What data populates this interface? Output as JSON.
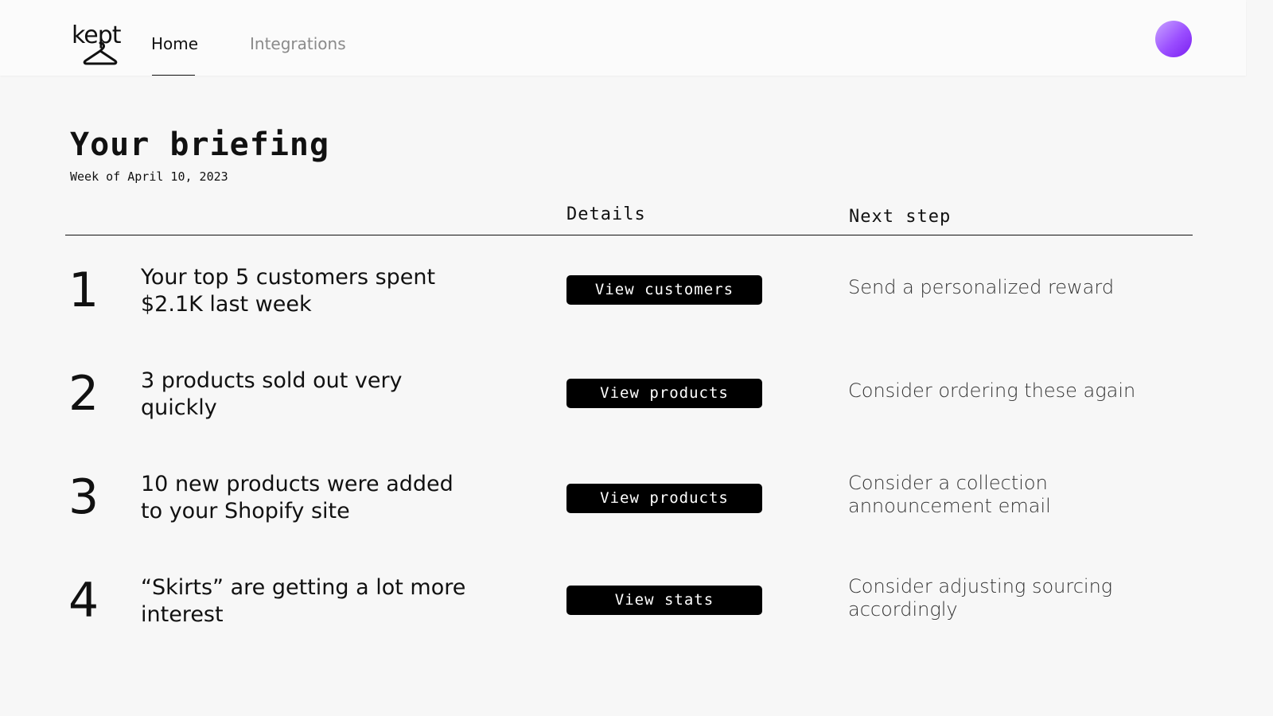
{
  "brand": {
    "logo_text": "kept"
  },
  "nav": {
    "tabs": [
      {
        "label": "Home",
        "active": true
      },
      {
        "label": "Integrations",
        "active": false
      }
    ]
  },
  "briefing": {
    "title": "Your briefing",
    "subtitle": "Week of April 10, 2023",
    "columns": {
      "details": "Details",
      "next_step": "Next step"
    },
    "rows": [
      {
        "number": "1",
        "text": "Your top 5 customers spent $2.1K last week",
        "button": "View customers",
        "next_step": "Send a personalized reward"
      },
      {
        "number": "2",
        "text": "3 products sold out very quickly",
        "button": "View products",
        "next_step": "Consider ordering these again"
      },
      {
        "number": "3",
        "text": "10 new products were added to your Shopify site",
        "button": "View products",
        "next_step": "Consider a collection announcement email"
      },
      {
        "number": "4",
        "text": "“Skirts” are getting a lot more interest",
        "button": "View stats",
        "next_step": "Consider adjusting sourcing accordingly"
      }
    ]
  },
  "colors": {
    "background": "#f7f7f7",
    "header": "#fbfbfb",
    "button": "#000000",
    "avatar_gradient": [
      "#c9a6ff",
      "#7a1ff0"
    ]
  },
  "icons": {
    "logo": "hanger-icon",
    "avatar": "user-avatar"
  }
}
